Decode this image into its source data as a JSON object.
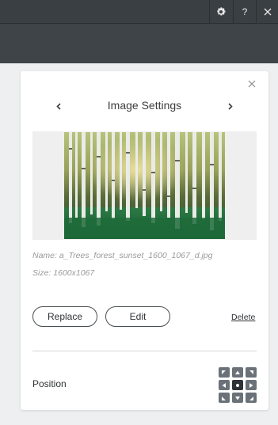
{
  "topbar": {
    "settings_icon": "gear-icon",
    "help_label": "?",
    "close_icon": "close-icon"
  },
  "panel": {
    "title": "Image Settings",
    "prev_icon": "chevron-left-icon",
    "next_icon": "chevron-right-icon",
    "close_icon": "close-icon"
  },
  "image": {
    "name_text": "Name: a_Trees_forest_sunset_1600_1067_d.jpg",
    "size_text": "Size: 1600x1067",
    "depicts": "birch forest at sunset"
  },
  "actions": {
    "replace_label": "Replace",
    "edit_label": "Edit",
    "delete_label": "Delete"
  },
  "position": {
    "label": "Position",
    "selected": "center",
    "cells": [
      "top-left",
      "top",
      "top-right",
      "left",
      "center",
      "right",
      "bottom-left",
      "bottom",
      "bottom-right"
    ]
  },
  "colors": {
    "topbar": "#3a3f43",
    "subbar": "#3f4448",
    "page_bg": "#eeeff1",
    "panel_bg": "#ffffff",
    "button_border": "#4a4f53",
    "pos_cell": "#6a7178",
    "pos_cell_active": "#2d3236"
  }
}
